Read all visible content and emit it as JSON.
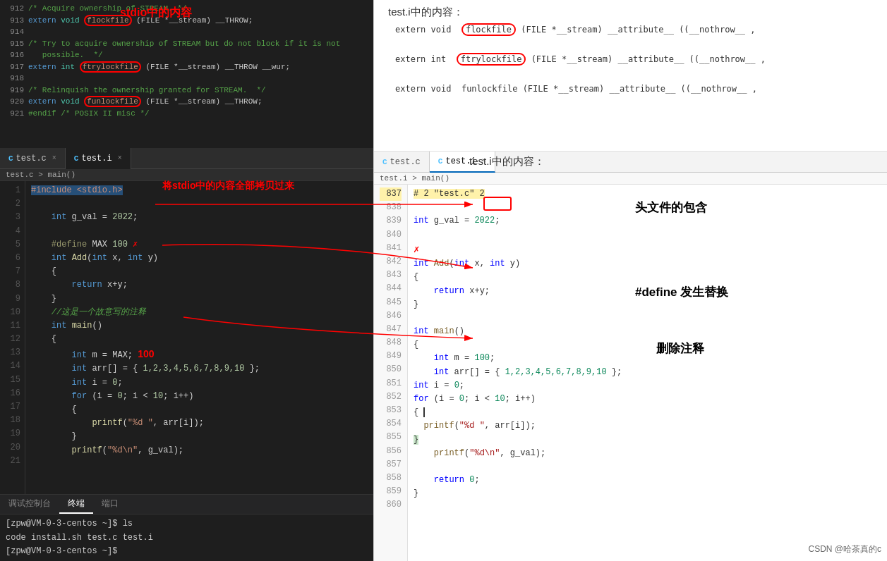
{
  "leftPane": {
    "stdioTitle": "stdio中的内容",
    "stdioLines": [
      {
        "num": "912",
        "text": "/* Acquire ownership of STREAM. */",
        "type": "comment"
      },
      {
        "num": "913",
        "text": "extern void flockfile (FILE *__stream) __THROW;",
        "type": "code",
        "highlight": "flockfile"
      },
      {
        "num": "914",
        "text": "",
        "type": "empty"
      },
      {
        "num": "915",
        "text": "/* Try to acquire ownership of STREAM but do not block if it is not",
        "type": "comment"
      },
      {
        "num": "916",
        "text": "   possible.  */",
        "type": "comment"
      },
      {
        "num": "917",
        "text": "extern int ftrylockfile (FILE *__stream) __THROW __wur;",
        "type": "code",
        "highlight": "ftrylockfile"
      },
      {
        "num": "918",
        "text": "",
        "type": "empty"
      },
      {
        "num": "919",
        "text": "/* Relinquish the ownership granted for STREAM. */",
        "type": "comment"
      },
      {
        "num": "920",
        "text": "extern void funlockfile (FILE *__stream) __THROW;",
        "type": "code",
        "highlight": "funlockfile"
      },
      {
        "num": "921",
        "text": "#endif /* POSIX II misc */",
        "type": "comment"
      }
    ],
    "tabs": [
      {
        "label": "test.c",
        "active": false,
        "icon": "C"
      },
      {
        "label": "test.i",
        "active": true,
        "icon": "C"
      }
    ],
    "breadcrumb": "test.c > main()",
    "codeLines": [
      {
        "num": "1",
        "code": "#include <stdio.h>",
        "highlight": true
      },
      {
        "num": "2",
        "code": ""
      },
      {
        "num": "3",
        "code": "    int g_val = 2022;"
      },
      {
        "num": "4",
        "code": ""
      },
      {
        "num": "5",
        "code": "    #define MAX 100 ✗"
      },
      {
        "num": "6",
        "code": "    int Add(int x, int y)"
      },
      {
        "num": "7",
        "code": "    {"
      },
      {
        "num": "8",
        "code": "        return x+y;"
      },
      {
        "num": "9",
        "code": "    }"
      },
      {
        "num": "10",
        "code": "    //这是一个故意写的注释"
      },
      {
        "num": "11",
        "code": "    int main()"
      },
      {
        "num": "12",
        "code": "    {"
      },
      {
        "num": "13",
        "code": "        int m = MAX;"
      },
      {
        "num": "14",
        "code": "        int arr[] = { 1,2,3,4,5,6,7,8,9,10 };"
      },
      {
        "num": "15",
        "code": "        int i = 0;"
      },
      {
        "num": "16",
        "code": "        for (i = 0; i < 10; i++)"
      },
      {
        "num": "17",
        "code": "        {"
      },
      {
        "num": "18",
        "code": "            printf(\"%d \", arr[i]);"
      },
      {
        "num": "19",
        "code": "        }"
      },
      {
        "num": "20",
        "code": "        printf(\"%d\\n\", g_val);"
      },
      {
        "num": "21",
        "code": ""
      }
    ],
    "terminal": {
      "tabs": [
        "调试控制台",
        "终端",
        "端口"
      ],
      "activeTab": "终端",
      "lines": [
        "[zpw@VM-0-3-centos ~]$ ls",
        "code  install.sh  test.c  test.i",
        "[zpw@VM-0-3-centos ~]$ "
      ]
    }
  },
  "rightPane": {
    "topAnnotations": {
      "title": "test.i中的内容：",
      "line1": "extern void  flockfile (FILE *__stream) __attribute__ ((__nothrow__ ,",
      "line1Highlight": "flockfile",
      "line2": "extern int  ftrylockfile  (FILE *__stream) __attribute__ ((__nothrow__ ,",
      "line2Highlight": "ftrylockfile",
      "line3": "extern void  funlockfile (FILE *__stream) __attribute__ ((__nothrow__ ,"
    },
    "tabs": [
      {
        "label": "test.c",
        "active": false,
        "icon": "C"
      },
      {
        "label": "test.i",
        "active": true,
        "icon": "C"
      }
    ],
    "breadcrumb": "test.i > main()",
    "codeLines": [
      {
        "num": "837",
        "code": "# 2 \"test.c\" 2",
        "boxed": true
      },
      {
        "num": "838",
        "code": ""
      },
      {
        "num": "839",
        "code": "int g_val = 2022;"
      },
      {
        "num": "840",
        "code": ""
      },
      {
        "num": "841",
        "code": "✗"
      },
      {
        "num": "842",
        "code": "int Add(int x, int y)"
      },
      {
        "num": "843",
        "code": "{"
      },
      {
        "num": "844",
        "code": "    return x+y;"
      },
      {
        "num": "845",
        "code": "}"
      },
      {
        "num": "846",
        "code": ""
      },
      {
        "num": "847",
        "code": "int main()"
      },
      {
        "num": "848",
        "code": "{"
      },
      {
        "num": "849",
        "code": "    int m = 100;"
      },
      {
        "num": "850",
        "code": "    int arr[] = { 1,2,3,4,5,6,7,8,9,10 };"
      },
      {
        "num": "851",
        "code": "int i = 0;"
      },
      {
        "num": "852",
        "code": "for (i = 0; i < 10; i++)"
      },
      {
        "num": "853",
        "code": "{|"
      },
      {
        "num": "854",
        "code": "  printf(\"%d \", arr[i]);"
      },
      {
        "num": "855",
        "code": "|}"
      },
      {
        "num": "856",
        "code": "    printf(\"%d\\n\", g_val);"
      },
      {
        "num": "857",
        "code": ""
      },
      {
        "num": "858",
        "code": "    return 0;"
      },
      {
        "num": "859",
        "code": "}"
      },
      {
        "num": "860",
        "code": ""
      }
    ],
    "annotations": {
      "arrow1": "将stdio中的内容全部拷贝过来",
      "arrow2": "头文件的包含",
      "arrow3": "#define 发生替换",
      "arrow4": "删除注释"
    }
  },
  "watermark": "CSDN @哈茶真的c"
}
